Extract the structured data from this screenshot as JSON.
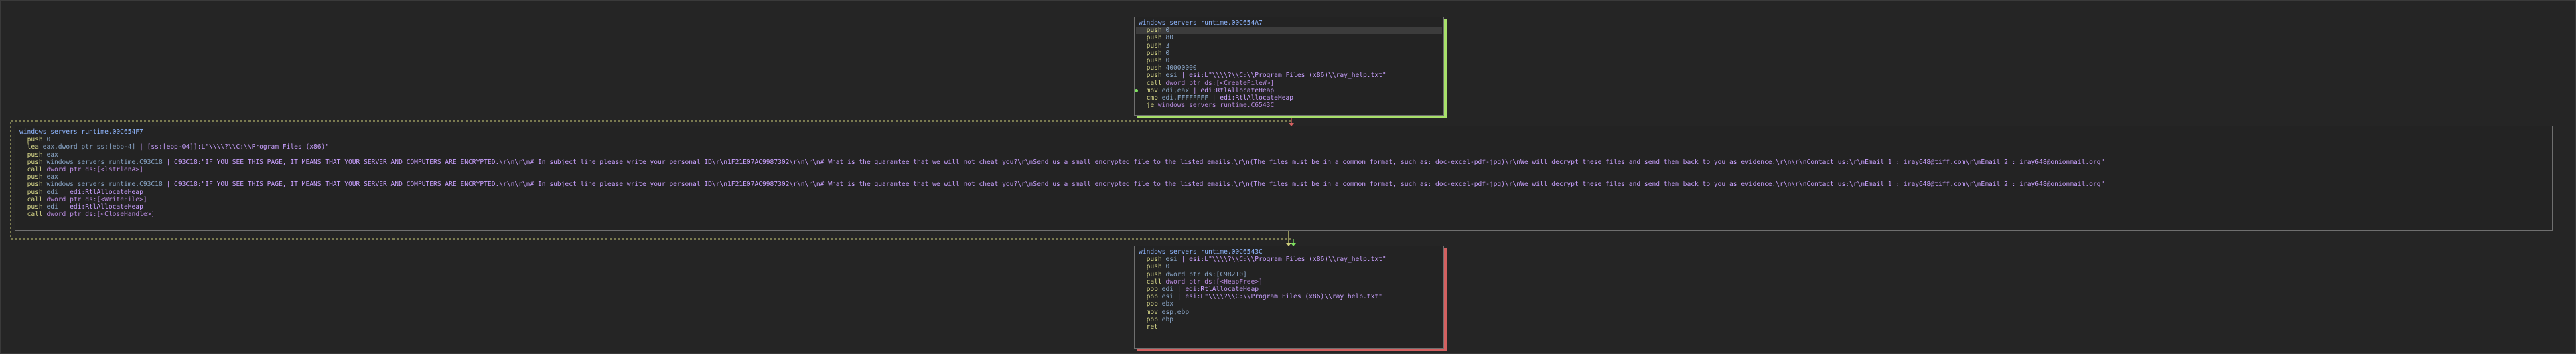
{
  "blocks": {
    "top": {
      "title": "windows servers runtime.00C654A7",
      "lines": [
        {
          "mn": "push",
          "op": "0",
          "tail": ""
        },
        {
          "mn": "push",
          "op": "80",
          "tail": ""
        },
        {
          "mn": "push",
          "op": "3",
          "tail": ""
        },
        {
          "mn": "push",
          "op": "0",
          "tail": ""
        },
        {
          "mn": "push",
          "op": "0",
          "tail": ""
        },
        {
          "mn": "push",
          "op": "40000000",
          "tail": ""
        },
        {
          "mn": "push",
          "op": "esi",
          "tail": " | esi:L\"\\\\\\\\?\\\\C:\\\\Program Files (x86)\\\\ray_help.txt\""
        },
        {
          "mn": "call",
          "op": "dword ptr ds:[<CreateFileW>]",
          "tail": ""
        },
        {
          "mn": "mov",
          "op": "edi,eax",
          "tail": " | edi:RtlAllocateHeap"
        },
        {
          "mn": "cmp",
          "op": "edi,FFFFFFFF",
          "tail": " | edi:RtlAllocateHeap"
        },
        {
          "mn": "je",
          "op": "windows servers runtime.C6543C",
          "tail": ""
        }
      ]
    },
    "mid": {
      "title": "windows servers runtime.00C654F7",
      "lines": [
        {
          "mn": "push",
          "op": "0",
          "tail": ""
        },
        {
          "mn": "lea",
          "op": "eax,dword ptr ss:[ebp-4]",
          "tail": " | [ss:[ebp-04]]:L\"\\\\\\\\?\\\\C:\\\\Program Files (x86)\""
        },
        {
          "mn": "push",
          "op": "eax",
          "tail": ""
        },
        {
          "mn": "push",
          "op": "windows servers runtime.C93C18",
          "tail": " | C93C18:\"IF YOU SEE THIS PAGE, IT MEANS THAT YOUR SERVER AND COMPUTERS ARE ENCRYPTED.\\r\\n\\r\\n# In subject line please write your personal ID\\r\\n1F21E07AC9987302\\r\\n\\r\\n# What is the guarantee that we will not cheat you?\\r\\nSend us a small encrypted file to the listed emails.\\r\\n(The files must be in a common format, such as: doc-excel-pdf-jpg)\\r\\nWe will decrypt these files and send them back to you as evidence.\\r\\n\\r\\nContact us:\\r\\nEmail 1 : iray648@tiff.com\\r\\nEmail 2 : iray648@onionmail.org\""
        },
        {
          "mn": "call",
          "op": "dword ptr ds:[<lstrlenA>]",
          "tail": ""
        },
        {
          "mn": "push",
          "op": "eax",
          "tail": ""
        },
        {
          "mn": "push",
          "op": "windows servers runtime.C93C18",
          "tail": " | C93C18:\"IF YOU SEE THIS PAGE, IT MEANS THAT YOUR SERVER AND COMPUTERS ARE ENCRYPTED.\\r\\n\\r\\n# In subject line please write your personal ID\\r\\n1F21E07AC9987302\\r\\n\\r\\n# What is the guarantee that we will not cheat you?\\r\\nSend us a small encrypted file to the listed emails.\\r\\n(The files must be in a common format, such as: doc-excel-pdf-jpg)\\r\\nWe will decrypt these files and send them back to you as evidence.\\r\\n\\r\\nContact us:\\r\\nEmail 1 : iray648@tiff.com\\r\\nEmail 2 : iray648@onionmail.org\""
        },
        {
          "mn": "push",
          "op": "edi",
          "tail": " | edi:RtlAllocateHeap"
        },
        {
          "mn": "call",
          "op": "dword ptr ds:[<WriteFile>]",
          "tail": ""
        },
        {
          "mn": "push",
          "op": "edi",
          "tail": " | edi:RtlAllocateHeap"
        },
        {
          "mn": "call",
          "op": "dword ptr ds:[<CloseHandle>]",
          "tail": ""
        }
      ]
    },
    "bot": {
      "title": "windows servers runtime.00C6543C",
      "lines": [
        {
          "mn": "push",
          "op": "esi",
          "tail": " | esi:L\"\\\\\\\\?\\\\C:\\\\Program Files (x86)\\\\ray_help.txt\""
        },
        {
          "mn": "push",
          "op": "0",
          "tail": ""
        },
        {
          "mn": "push",
          "op": "dword ptr ds:[C9B210]",
          "tail": ""
        },
        {
          "mn": "call",
          "op": "dword ptr ds:[<HeapFree>]",
          "tail": ""
        },
        {
          "mn": "pop",
          "op": "edi",
          "tail": " | edi:RtlAllocateHeap"
        },
        {
          "mn": "pop",
          "op": "esi",
          "tail": " | esi:L\"\\\\\\\\?\\\\C:\\\\Program Files (x86)\\\\ray_help.txt\""
        },
        {
          "mn": "pop",
          "op": "ebx",
          "tail": ""
        },
        {
          "mn": "mov",
          "op": "esp,ebp",
          "tail": ""
        },
        {
          "mn": "pop",
          "op": "ebp",
          "tail": ""
        },
        {
          "mn": "ret",
          "op": "",
          "tail": ""
        }
      ]
    }
  },
  "colors": {
    "background": "#262626",
    "true_branch": "#a7e06a",
    "false_branch": "#d26060",
    "flow_edge": "#cfcf7a",
    "title": "#8fb6ff"
  }
}
